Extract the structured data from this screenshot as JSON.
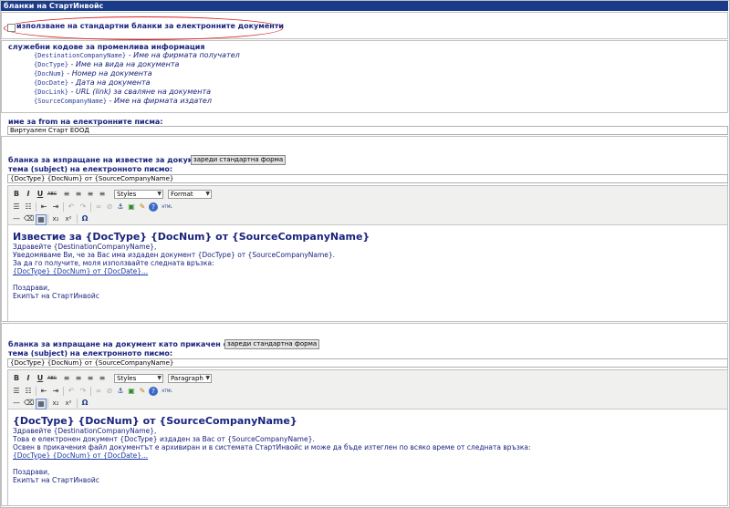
{
  "header": {
    "title": "бланки на СтартИнвойс"
  },
  "standard_forms": {
    "checkbox_label": "използване на стандартни бланки за електронните документи"
  },
  "codes": {
    "heading": "служебни кодове за променлива информация",
    "items": [
      {
        "code": "{DestinationCompanyName}",
        "desc": " - Име на фирмата получател"
      },
      {
        "code": "{DocType}",
        "desc": " - Име на вида на документа"
      },
      {
        "code": "{DocNum}",
        "desc": " - Номер на документа"
      },
      {
        "code": "{DocDate}",
        "desc": " - Дата на документа"
      },
      {
        "code": "{DocLink}",
        "desc": " - URL (link) за сваляне на документа"
      },
      {
        "code": "{SourceCompanyName}",
        "desc": " - Име на фирмата издател"
      }
    ]
  },
  "from_name": {
    "label": "име за from на електронните писма:",
    "value": "Виртуален Старт ЕООД"
  },
  "notice_form": {
    "heading": "бланка за изпращане на известие за документ",
    "load_button": "зареди стандартна форма",
    "subject_label": "тема (subject) на електронното писмо:",
    "subject_value": "{DocType}  {DocNum} от {SourceCompanyName}",
    "styles_value": "Styles",
    "format_value": "Format",
    "body": {
      "title": "Известие за {DocType} {DocNum} от {SourceCompanyName}",
      "lines": [
        "Здравейте {DestinationCompanyName},",
        "Уведомяваме Ви, че за Вас има издаден документ {DocType} от {SourceCompanyName}.",
        "За да го получите, моля използвайте следната връзка:"
      ],
      "link": "{DocType} {DocNum} от {DocDate}...",
      "closing": [
        "Поздрави,",
        "Екипът на СтартИнвойс"
      ]
    }
  },
  "attach_form": {
    "heading": "бланка за изпращане на документ като прикачен файл",
    "load_button": "зареди стандартна форма",
    "subject_label": "тема (subject) на електронното писмо:",
    "subject_value": "{DocType}  {DocNum} от {SourceCompanyName}",
    "styles_value": "Styles",
    "format_value": "Paragraph",
    "body": {
      "title": "{DocType} {DocNum} от {SourceCompanyName}",
      "lines": [
        "Здравейте {DestinationCompanyName},",
        "Това е електронен документ {DocType} издаден за Вас от {SourceCompanyName}.",
        "Освен в прикачения файл документът е архивиран и в системата СтартИнвойс и може да бъде изтеглен по всяко време от следната връзка:"
      ],
      "link": "{DocType} {DocNum} от {DocDate}...",
      "closing": [
        "Поздрави,",
        "Екипът на СтартИнвойс"
      ]
    }
  },
  "icons": {
    "bold": "B",
    "italic": "I",
    "underline": "U",
    "strike": "ABC",
    "align_left": "≡",
    "align_center": "≡",
    "align_right": "≡",
    "align_justify": "≡",
    "bullets": "☰",
    "numbers": "☷",
    "outdent": "⇤",
    "indent": "⇥",
    "undo": "↶",
    "redo": "↷",
    "link": "∞",
    "unlink": "⊘",
    "anchor": "⚓",
    "image": "▣",
    "cleanup": "✎",
    "help": "?",
    "html": "HTML",
    "hr": "—",
    "removeformat": "⌫",
    "visualaid": "▦",
    "sub": "x₂",
    "sup": "x²",
    "omega": "Ω"
  }
}
